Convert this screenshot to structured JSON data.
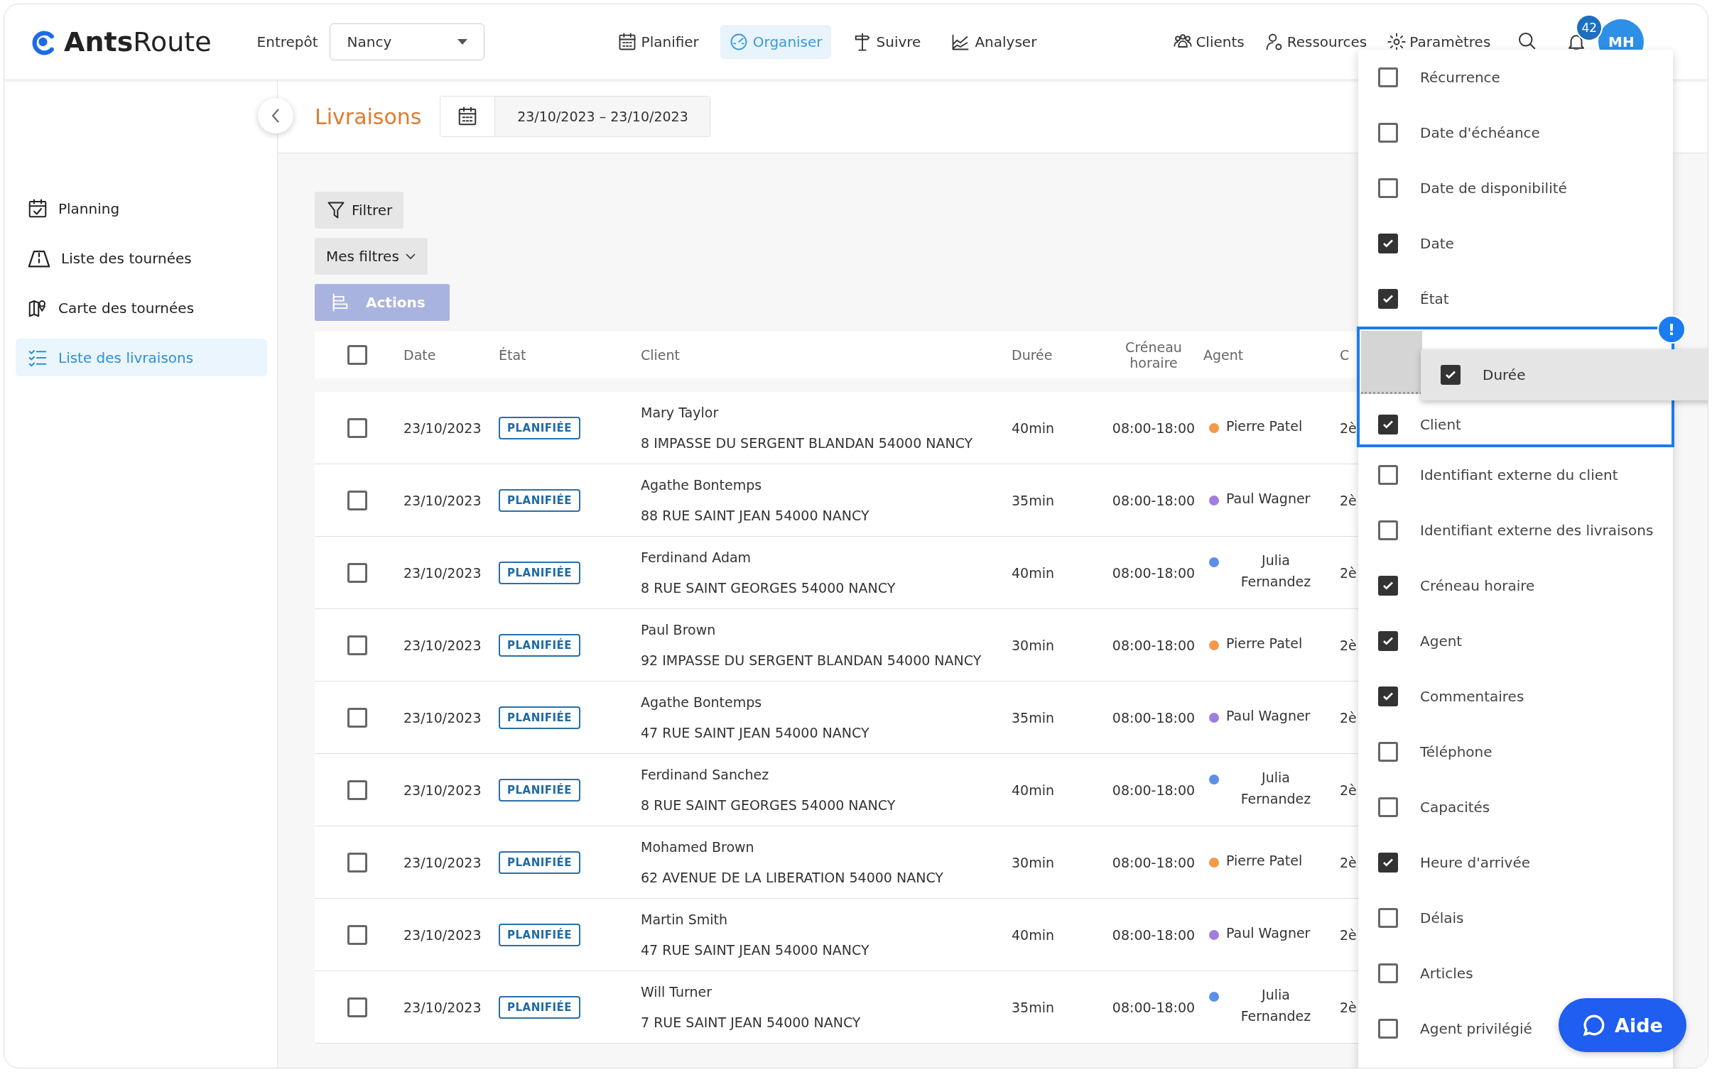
{
  "topbar": {
    "logo": "**Ants**Route",
    "warehouse_label": "Entrepôt",
    "warehouse_select": "Nancy",
    "nav": [
      {
        "label": "Planifier",
        "selected": false
      },
      {
        "label": "Organiser",
        "selected": true
      },
      {
        "label": "Suivre",
        "selected": false
      },
      {
        "label": "Analyser",
        "selected": false
      }
    ],
    "links": [
      "Clients",
      "Ressources",
      "Paramètres"
    ],
    "notification_count": "42",
    "avatar": "MH"
  },
  "sidebar": {
    "items": [
      {
        "label": "Planning",
        "selected": false
      },
      {
        "label": "Liste des tournées",
        "selected": false
      },
      {
        "label": "Carte des tournées",
        "selected": false
      },
      {
        "label": "Liste des livraisons",
        "selected": true
      }
    ]
  },
  "header": {
    "title": "Livraisons",
    "date_range": "23/10/2023 – 23/10/2023"
  },
  "toolbar": {
    "filter": "Filtrer",
    "my_filters": "Mes filtres",
    "actions": "Actions"
  },
  "table": {
    "all_selected": false,
    "columns": [
      "Date",
      "État",
      "Client",
      "Durée",
      "Créneau horaire",
      "Agent",
      "C"
    ],
    "rows": [
      {
        "selected": false,
        "date": "23/10/2023",
        "status": "PLANIFIÉE",
        "client": "Mary Taylor",
        "address": "8 IMPASSE DU SERGENT BLANDAN 54000 NANCY",
        "duration": "40min",
        "time_window": "08:00-18:00",
        "agent": {
          "name": "Pierre Patel",
          "color": "#f39a4a"
        },
        "column_8": "2è"
      },
      {
        "selected": false,
        "date": "23/10/2023",
        "status": "PLANIFIÉE",
        "client": "Agathe Bontemps",
        "address": "88 RUE SAINT JEAN 54000 NANCY",
        "duration": "35min",
        "time_window": "08:00-18:00",
        "agent": {
          "name": "Paul Wagner",
          "color": "#a07ee0"
        },
        "column_8": "2è"
      },
      {
        "selected": false,
        "date": "23/10/2023",
        "status": "PLANIFIÉE",
        "client": "Ferdinand Adam",
        "address": "8 RUE SAINT GEORGES 54000 NANCY",
        "duration": "40min",
        "time_window": "08:00-18:00",
        "agent": {
          "name": "Julia Fernandez",
          "color": "#5b8fe8"
        },
        "column_8": "2è"
      },
      {
        "selected": false,
        "date": "23/10/2023",
        "status": "PLANIFIÉE",
        "client": "Paul Brown",
        "address": "92 IMPASSE DU SERGENT BLANDAN 54000 NANCY",
        "duration": "30min",
        "time_window": "08:00-18:00",
        "agent": {
          "name": "Pierre Patel",
          "color": "#f39a4a"
        },
        "column_8": "2è"
      },
      {
        "selected": false,
        "date": "23/10/2023",
        "status": "PLANIFIÉE",
        "client": "Agathe Bontemps",
        "address": "47 RUE SAINT JEAN 54000 NANCY",
        "duration": "35min",
        "time_window": "08:00-18:00",
        "agent": {
          "name": "Paul Wagner",
          "color": "#a07ee0"
        },
        "column_8": "2è"
      },
      {
        "selected": false,
        "date": "23/10/2023",
        "status": "PLANIFIÉE",
        "client": "Ferdinand Sanchez",
        "address": "8 RUE SAINT GEORGES 54000 NANCY",
        "duration": "40min",
        "time_window": "08:00-18:00",
        "agent": {
          "name": "Julia Fernandez",
          "color": "#5b8fe8"
        },
        "column_8": "2è"
      },
      {
        "selected": false,
        "date": "23/10/2023",
        "status": "PLANIFIÉE",
        "client": "Mohamed Brown",
        "address": "62 AVENUE DE LA LIBERATION 54000 NANCY",
        "duration": "30min",
        "time_window": "08:00-18:00",
        "agent": {
          "name": "Pierre Patel",
          "color": "#f39a4a"
        },
        "column_8": "2è"
      },
      {
        "selected": false,
        "date": "23/10/2023",
        "status": "PLANIFIÉE",
        "client": "Martin Smith",
        "address": "47 RUE SAINT JEAN 54000 NANCY",
        "duration": "40min",
        "time_window": "08:00-18:00",
        "agent": {
          "name": "Paul Wagner",
          "color": "#a07ee0"
        },
        "column_8": "2è"
      },
      {
        "selected": false,
        "date": "23/10/2023",
        "status": "PLANIFIÉE",
        "client": "Will Turner",
        "address": "7 RUE SAINT JEAN 54000 NANCY",
        "duration": "35min",
        "time_window": "08:00-18:00",
        "agent": {
          "name": "Julia Fernandez",
          "color": "#5b8fe8"
        },
        "column_8": "2è"
      }
    ]
  },
  "column_menu": {
    "items": [
      {
        "label": "Récurrence",
        "checked": false,
        "highlighted": false
      },
      {
        "label": "Date d'échéance",
        "checked": false,
        "highlighted": false
      },
      {
        "label": "Date de disponibilité",
        "checked": false,
        "highlighted": false
      },
      {
        "label": "Date",
        "checked": true,
        "highlighted": false
      },
      {
        "label": "État",
        "checked": true,
        "highlighted": false
      },
      {
        "label": "Client",
        "checked": true,
        "highlighted": true
      },
      {
        "label": "Identifiant externe du client",
        "checked": false,
        "highlighted": false
      },
      {
        "label": "Identifiant externe des livraisons",
        "checked": false,
        "highlighted": false
      },
      {
        "label": "Créneau horaire",
        "checked": true,
        "highlighted": false
      },
      {
        "label": "Agent",
        "checked": true,
        "highlighted": false
      },
      {
        "label": "Commentaires",
        "checked": true,
        "highlighted": false
      },
      {
        "label": "Téléphone",
        "checked": false,
        "highlighted": false
      },
      {
        "label": "Capacités",
        "checked": false,
        "highlighted": false
      },
      {
        "label": "Heure d'arrivée",
        "checked": true,
        "highlighted": false
      },
      {
        "label": "Délais",
        "checked": false,
        "highlighted": false
      },
      {
        "label": "Articles",
        "checked": false,
        "highlighted": false
      },
      {
        "label": "Agent privilégié",
        "checked": false,
        "highlighted": false
      }
    ],
    "dragged_item": {
      "label": "Durée",
      "checked": true
    },
    "warning_badge": "!"
  },
  "help_button": "Aide"
}
